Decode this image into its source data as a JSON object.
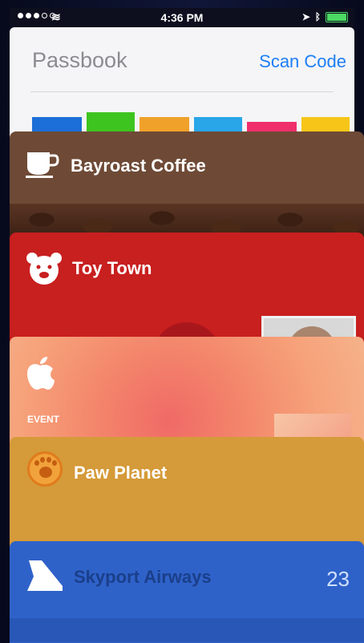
{
  "status_bar": {
    "time": "4:36 PM"
  },
  "passbook": {
    "title": "Passbook",
    "scan_code_label": "Scan Code",
    "pass_strip_colors": [
      "#1c6fd8",
      "#3ec41f",
      "#f0a12a",
      "#28a6e8",
      "#ef2f6b",
      "#f6c518"
    ]
  },
  "cards": [
    {
      "label": "Bayroast Coffee",
      "color": "#6e4a36",
      "icon": "coffee-cup-icon"
    },
    {
      "label": "Toy Town",
      "color": "#c81f1f",
      "icon": "bear-icon"
    },
    {
      "label": "",
      "color": "#f3866b",
      "icon": "apple-icon",
      "event_label": "EVENT"
    },
    {
      "label": "Paw Planet",
      "color": "#d59a39",
      "icon": "paw-icon"
    },
    {
      "label": "Skyport Airways",
      "color": "#2f62c9",
      "icon": "plane-tail-icon"
    }
  ],
  "skyport": {
    "date": "23"
  }
}
